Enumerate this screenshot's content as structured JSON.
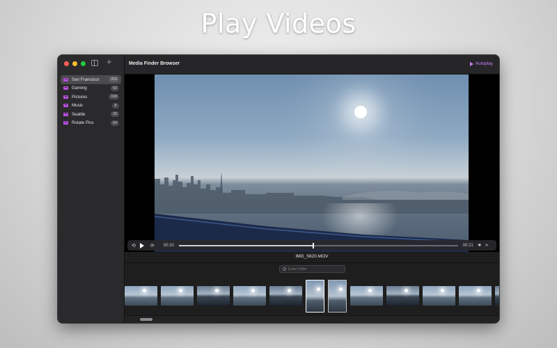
{
  "headline": "Play Videos",
  "window": {
    "title": "Media Finder Browser",
    "autoplay_label": "Autoplay",
    "accent": "#c77dff"
  },
  "sidebar": {
    "items": [
      {
        "label": "San Francisco",
        "count": "316",
        "active": true
      },
      {
        "label": "Gaming",
        "count": "52",
        "active": false
      },
      {
        "label": "Pictures",
        "count": "168",
        "active": false
      },
      {
        "label": "Music",
        "count": "8",
        "active": false
      },
      {
        "label": "Seattle",
        "count": "29",
        "active": false
      },
      {
        "label": "Rotate Pics",
        "count": "64",
        "active": false
      }
    ],
    "icon_color": "#b94fe0"
  },
  "player": {
    "current_time": "00:10",
    "end_time": "00:21",
    "progress": 0.48
  },
  "file": {
    "name": "IMG_5620.MOV"
  },
  "filter": {
    "placeholder": "Enter Filter",
    "value": ""
  },
  "thumbnails": [
    {
      "kind": "landscape",
      "selected": false
    },
    {
      "kind": "landscape",
      "selected": false
    },
    {
      "kind": "dark",
      "selected": false
    },
    {
      "kind": "landscape",
      "selected": false
    },
    {
      "kind": "dark",
      "selected": false
    },
    {
      "kind": "portrait",
      "selected": true
    },
    {
      "kind": "portrait",
      "selected": false
    },
    {
      "kind": "landscape",
      "selected": false
    },
    {
      "kind": "dark",
      "selected": false
    },
    {
      "kind": "landscape",
      "selected": false
    },
    {
      "kind": "landscape",
      "selected": false
    },
    {
      "kind": "dark",
      "selected": false
    }
  ]
}
